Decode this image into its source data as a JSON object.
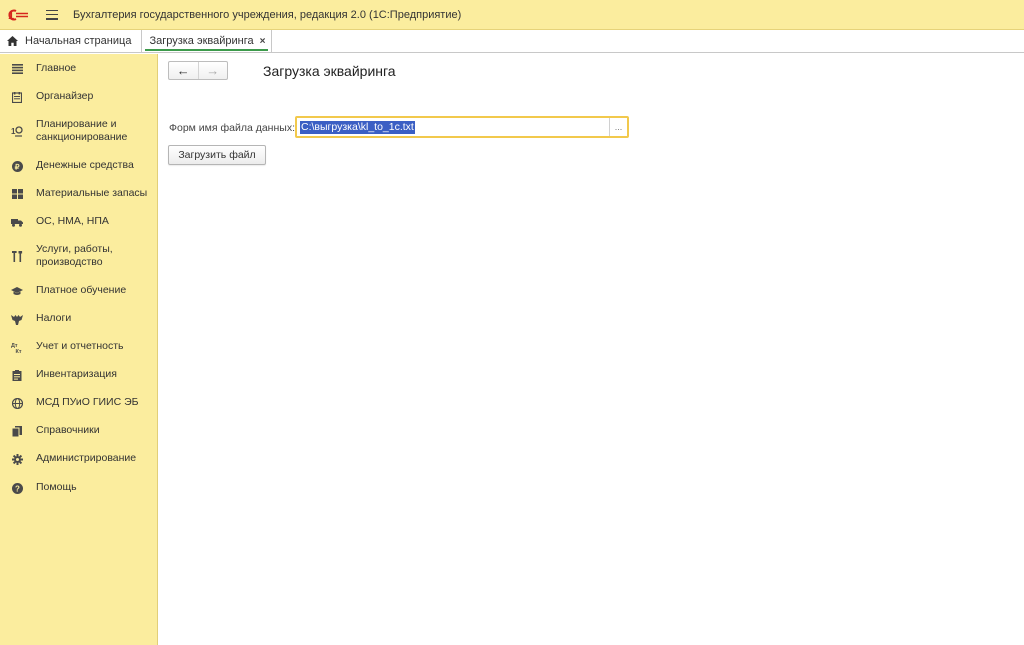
{
  "window": {
    "title": "Бухгалтерия государственного учреждения, редакция 2.0  (1С:Предприятие)",
    "logo_text": "1С"
  },
  "tabs": {
    "home": "Начальная страница",
    "open": "Загрузка эквайринга",
    "close_glyph": "×"
  },
  "sidebar": {
    "items": [
      {
        "label": "Главное",
        "icon": "list-icon"
      },
      {
        "label": "Органайзер",
        "icon": "calendar-icon"
      },
      {
        "label": "Планирование и санкционирование",
        "icon": "planning-icon"
      },
      {
        "label": "Денежные средства",
        "icon": "ruble-icon"
      },
      {
        "label": "Материальные запасы",
        "icon": "grid-icon"
      },
      {
        "label": "ОС, НМА, НПА",
        "icon": "truck-icon"
      },
      {
        "label": "Услуги, работы, производство",
        "icon": "tools-icon"
      },
      {
        "label": "Платное обучение",
        "icon": "graduation-cap-icon"
      },
      {
        "label": "Налоги",
        "icon": "eagle-icon"
      },
      {
        "label": "Учет и отчетность",
        "icon": "accounts-icon"
      },
      {
        "label": "Инвентаризация",
        "icon": "clipboard-icon"
      },
      {
        "label": "МСД ПУиО ГИИС ЭБ",
        "icon": "globe-icon"
      },
      {
        "label": "Справочники",
        "icon": "books-icon"
      },
      {
        "label": "Администрирование",
        "icon": "gear-icon"
      },
      {
        "label": "Помощь",
        "icon": "help-icon"
      }
    ]
  },
  "form": {
    "title": "Загрузка эквайринга",
    "nav_back": "←",
    "nav_forward": "→",
    "file_label": "Форм имя файла данных:",
    "file_value": "C:\\выгрузка\\kl_to_1c.txt",
    "pick_glyph": "...",
    "load_button": "Загрузить файл"
  },
  "colors": {
    "panel": "#fbed9e",
    "active_tab_underline": "#3c9a4b",
    "field_focus": "#f2c94c",
    "selection": "#3b5fc4"
  }
}
